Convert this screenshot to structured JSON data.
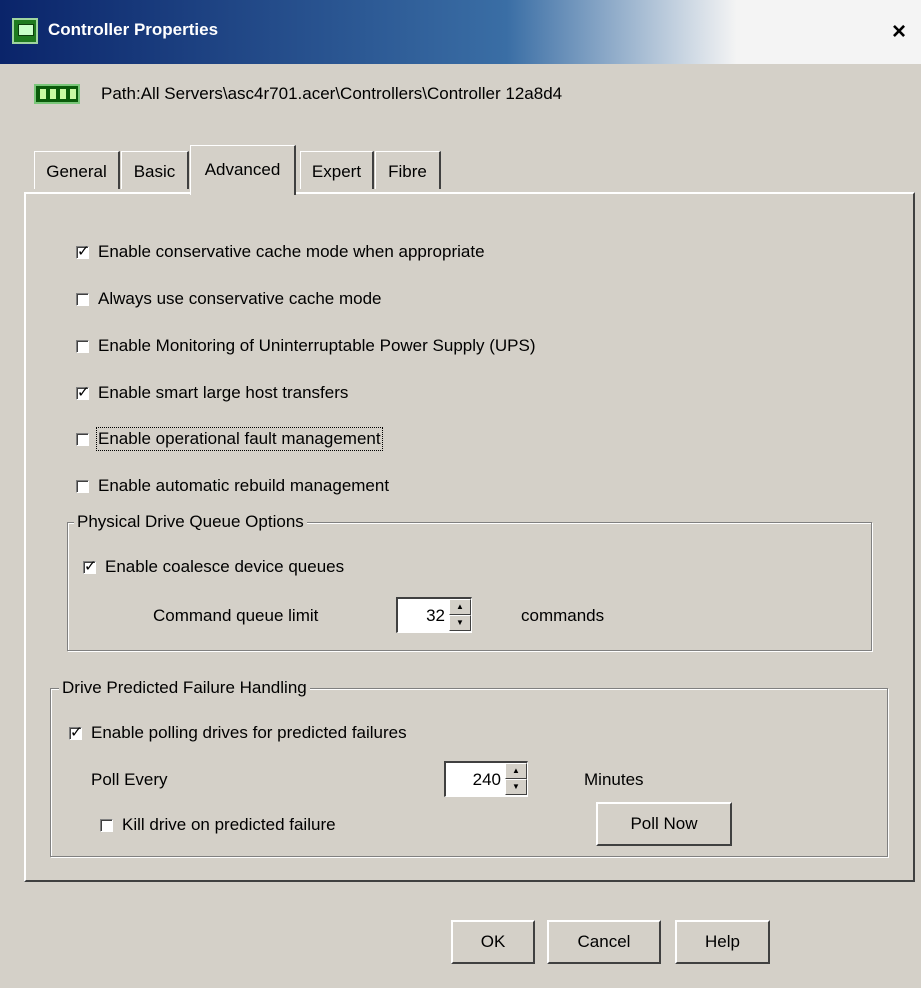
{
  "window": {
    "title": "Controller Properties",
    "close_glyph": "×"
  },
  "path": {
    "label": "Path:All Servers\\asc4r701.acer\\Controllers\\Controller 12a8d4"
  },
  "tabs": [
    {
      "label": "General",
      "active": false
    },
    {
      "label": "Basic",
      "active": false
    },
    {
      "label": "Advanced",
      "active": true
    },
    {
      "label": "Expert",
      "active": false
    },
    {
      "label": "Fibre",
      "active": false
    }
  ],
  "advanced": {
    "options": [
      {
        "label": "Enable conservative cache mode when appropriate",
        "checked": true
      },
      {
        "label": "Always use conservative cache mode",
        "checked": false
      },
      {
        "label": "Enable Monitoring of Uninterruptable Power Supply (UPS)",
        "checked": false
      },
      {
        "label": "Enable smart large host transfers",
        "checked": true
      },
      {
        "label": "Enable operational fault management",
        "checked": false,
        "focused": true
      },
      {
        "label": "Enable automatic rebuild management",
        "checked": false
      }
    ],
    "queue_group": {
      "title": "Physical Drive Queue Options",
      "coalesce": {
        "label": "Enable coalesce device queues",
        "checked": true
      },
      "limit_label": "Command queue limit",
      "limit_value": "32",
      "limit_unit": "commands"
    },
    "failure_group": {
      "title": "Drive Predicted Failure Handling",
      "polling": {
        "label": "Enable polling drives for predicted failures",
        "checked": true
      },
      "poll_label": "Poll Every",
      "poll_value": "240",
      "poll_unit": "Minutes",
      "kill": {
        "label": "Kill drive on predicted failure",
        "checked": false
      },
      "poll_now": "Poll Now"
    }
  },
  "buttons": {
    "ok": "OK",
    "cancel": "Cancel",
    "help": "Help"
  },
  "icons": {
    "title_icon": "controller-icon",
    "path_icon": "controller-board-icon",
    "close_icon": "close-icon",
    "spin_up": "▲",
    "spin_down": "▼"
  },
  "colors": {
    "dialog_bg": "#d4d0c8",
    "titlebar_start": "#0a246a",
    "titlebar_end": "#f4f4f4",
    "title_text": "#ffffff"
  }
}
